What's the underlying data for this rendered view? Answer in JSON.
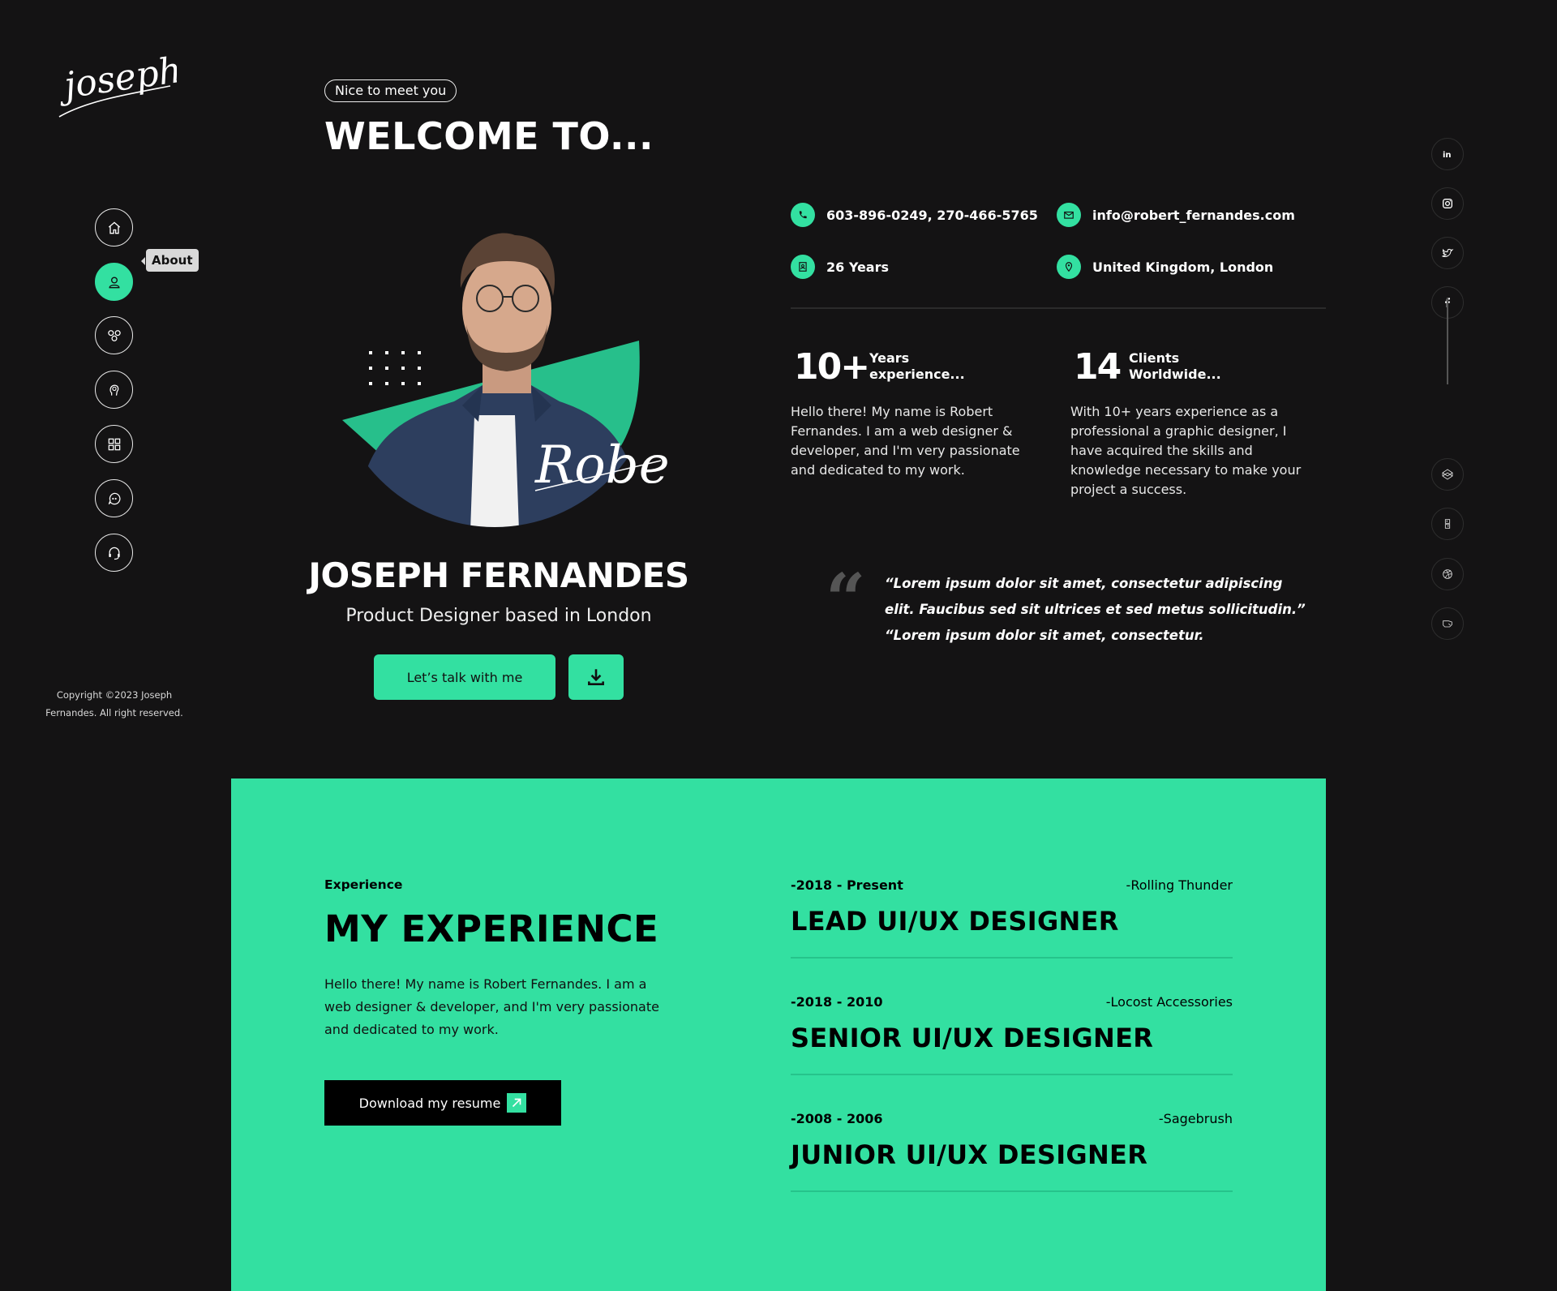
{
  "brand": {
    "logo_text": "joseph",
    "accent": "#33e0a1",
    "background": "#141314"
  },
  "nav": {
    "items": [
      {
        "name": "home",
        "icon": "home-icon"
      },
      {
        "name": "about",
        "icon": "user-icon",
        "active": true
      },
      {
        "name": "services",
        "icon": "gears-icon"
      },
      {
        "name": "skills",
        "icon": "brain-icon"
      },
      {
        "name": "portfolio",
        "icon": "grid-icon"
      },
      {
        "name": "testimonials",
        "icon": "chat-icon"
      },
      {
        "name": "contact",
        "icon": "headset-icon"
      }
    ],
    "tooltip": "About",
    "copyright": "Copyright ©2023 Joseph Fernandes. All right reserved."
  },
  "hero": {
    "pill": "Nice to meet you",
    "welcome": "WELCOME TO...",
    "signature": "Robert",
    "name": "JOSEPH FERNANDES",
    "subtitle": "Product Designer based in London",
    "talk_button": "Let’s talk with me",
    "download_icon": "download-icon"
  },
  "contacts": {
    "phone": "603-896-0249, 270-466-5765",
    "email": "info@robert_fernandes.com",
    "age": "26 Years",
    "location": "United Kingdom, London"
  },
  "stats": [
    {
      "number": "10+",
      "label_1": "Years",
      "label_2": "experience...",
      "text": "Hello there! My name is Robert Fernandes. I am a web designer & developer, and I'm very passionate and dedicated to my work."
    },
    {
      "number": "14",
      "label_1": "Clients",
      "label_2": "Worldwide...",
      "text": "With 10+ years experience as a professional a graphic designer, I have acquired the skills and knowledge necessary to make your project a success."
    }
  ],
  "quote": {
    "mark": "“",
    "text": "“Lorem ipsum dolor sit amet, consectetur adipiscing elit. Faucibus sed sit ultrices et sed metus sollicitudin.” “Lorem ipsum dolor sit amet, consectetur."
  },
  "social": {
    "top": [
      "linkedin-icon",
      "instagram-icon",
      "twitter-icon",
      "facebook-icon"
    ],
    "bottom": [
      "codepen-icon",
      "qr-icon",
      "dribbble-icon",
      "hand-icon"
    ]
  },
  "experience": {
    "kicker": "Experience",
    "title": "MY EXPERIENCE",
    "description": "Hello there! My name is Robert Fernandes. I am a web designer & developer, and I'm very passionate and dedicated to my work.",
    "button": "Download my resume",
    "jobs": [
      {
        "dates": "-2018 - Present",
        "company": "-Rolling Thunder",
        "title": "LEAD UI/UX DESIGNER"
      },
      {
        "dates": "-2018 - 2010",
        "company": "-Locost Accessories",
        "title": "SENIOR UI/UX DESIGNER"
      },
      {
        "dates": "-2008 - 2006",
        "company": "-Sagebrush",
        "title": "JUNIOR UI/UX DESIGNER"
      }
    ]
  }
}
